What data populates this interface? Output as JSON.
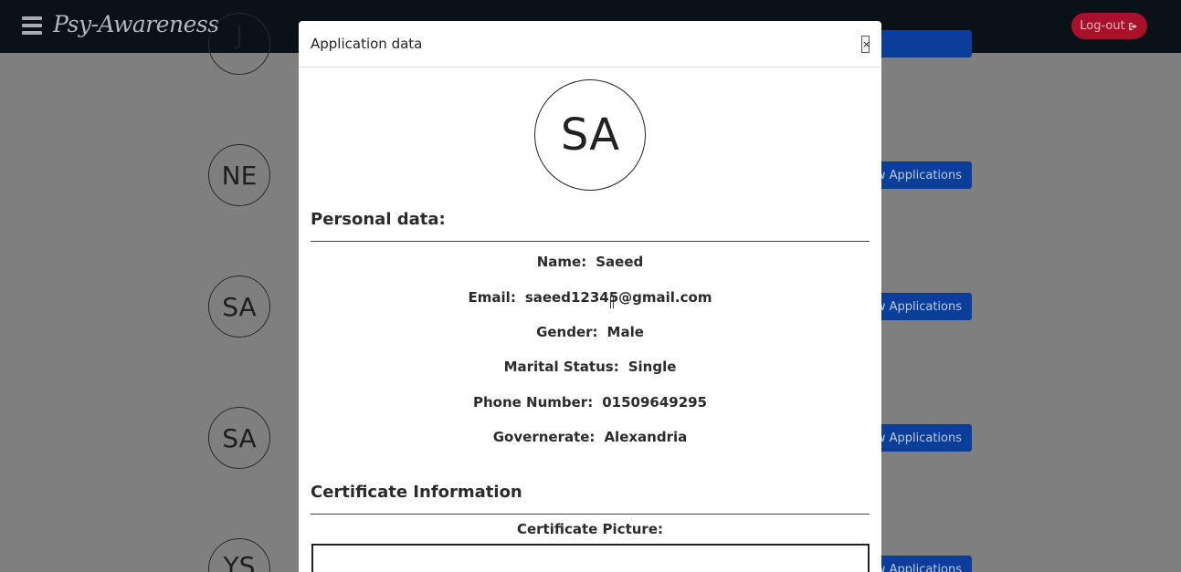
{
  "navbar": {
    "brand": "Psy-Awareness",
    "logout_label": "Log-out",
    "logout_icon": "sign-out-icon"
  },
  "background_list": {
    "avatars": [
      "NE",
      "SA",
      "SA",
      "YS"
    ],
    "button_label": "ew Applications"
  },
  "modal": {
    "title": "Application data",
    "close_label": "×",
    "avatar_initials": "SA",
    "personal_heading": "Personal data:",
    "fields": [
      {
        "label": "Name:",
        "value": "Saeed"
      },
      {
        "label": "Email:",
        "value": "saeed12345@gmail.com"
      },
      {
        "label": "Gender:",
        "value": "Male"
      },
      {
        "label": "Marital Status:",
        "value": "Single"
      },
      {
        "label": "Phone Number:",
        "value": "01509649295"
      },
      {
        "label": "Governerate:",
        "value": "Alexandria"
      }
    ],
    "certificate_heading": "Certificate Information",
    "certificate_picture_label": "Certificate Picture:"
  },
  "colors": {
    "navbar_bg": "#0a1119",
    "logout_bg": "#a8102b",
    "button_bg": "#0b3d9b",
    "overlay": "#7f7f7f"
  }
}
